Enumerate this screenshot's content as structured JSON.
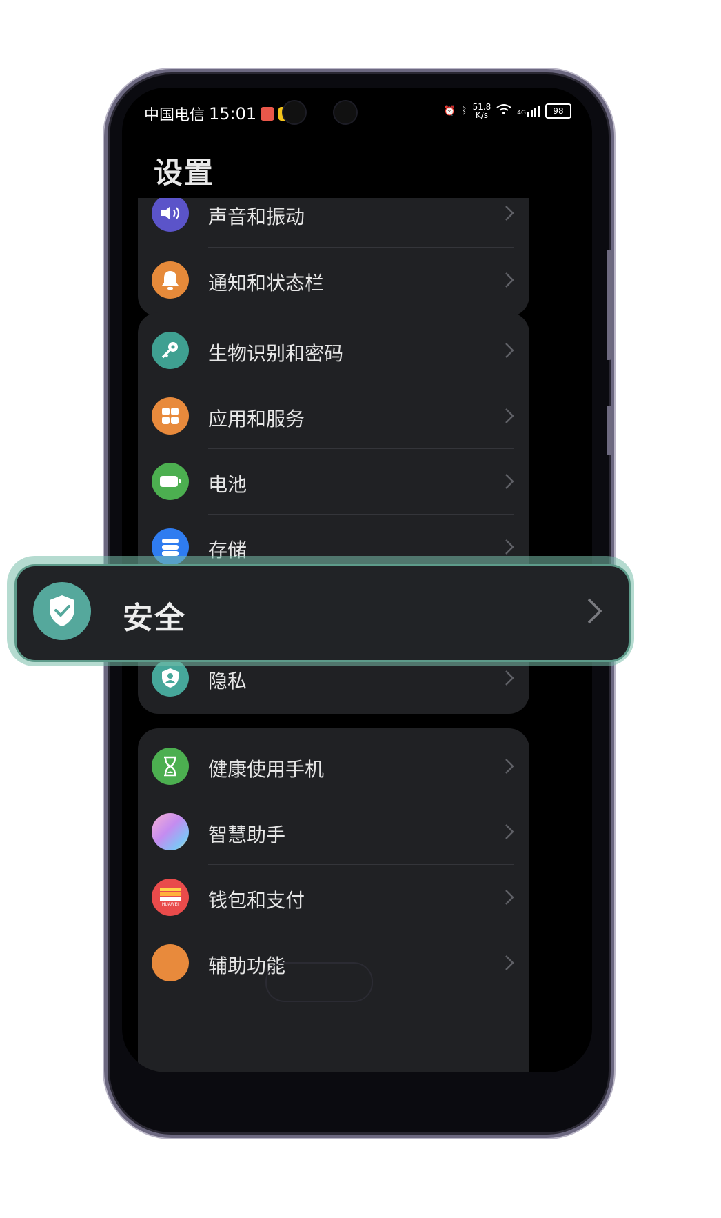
{
  "statusbar": {
    "carrier": "中国电信",
    "time": "15:01",
    "speed_value": "51.8",
    "speed_unit": "K/s",
    "network": "4G",
    "battery": "98"
  },
  "page": {
    "title": "设置"
  },
  "groups": [
    {
      "items": [
        {
          "label": "声音和振动",
          "icon": "speaker-icon",
          "color": "#5b54c9"
        },
        {
          "label": "通知和状态栏",
          "icon": "bell-icon",
          "color": "#e68a3a"
        }
      ]
    },
    {
      "items": [
        {
          "label": "生物识别和密码",
          "icon": "key-icon",
          "color": "#3fa091"
        },
        {
          "label": "应用和服务",
          "icon": "apps-grid-icon",
          "color": "#e88a3c"
        },
        {
          "label": "电池",
          "icon": "battery-icon",
          "color": "#4caf50"
        },
        {
          "label": "存储",
          "icon": "storage-icon",
          "color": "#2f7cf0"
        },
        {
          "label": "隐私",
          "icon": "privacy-shield-icon",
          "color": "#46a79a"
        }
      ]
    },
    {
      "items": [
        {
          "label": "健康使用手机",
          "icon": "hourglass-icon",
          "color": "#4caf50"
        },
        {
          "label": "智慧助手",
          "icon": "assistant-icon",
          "color": "#c48cf0"
        },
        {
          "label": "钱包和支付",
          "icon": "wallet-icon",
          "color": "#e94b4b"
        },
        {
          "label": "辅助功能",
          "icon": "accessibility-icon",
          "color": "#e88a3c"
        }
      ]
    }
  ],
  "wallet_badge": "HUAWEI",
  "highlight": {
    "label": "安全",
    "icon": "security-shield-icon",
    "color": "#55a89c"
  }
}
